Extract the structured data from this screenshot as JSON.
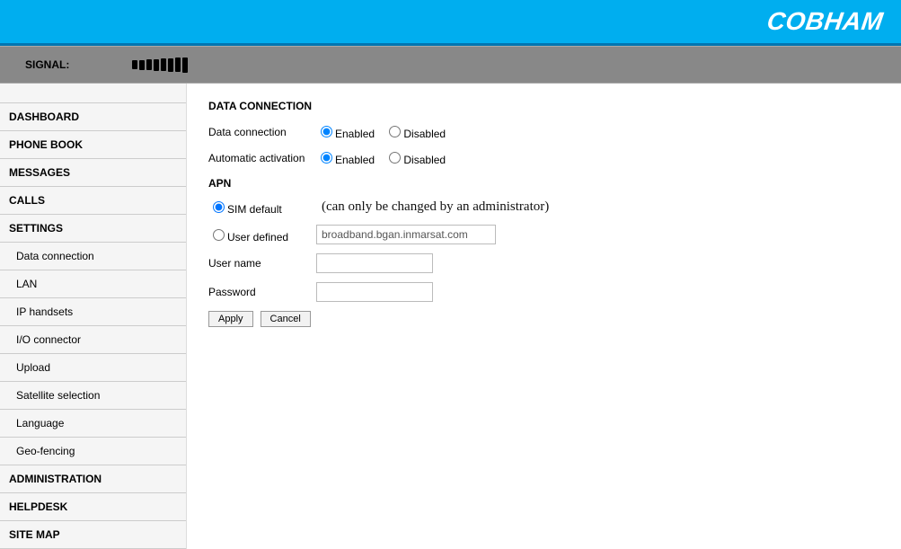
{
  "brand": "COBHAM",
  "signal": {
    "label": "SIGNAL:"
  },
  "sidebar": {
    "items": [
      {
        "label": "DASHBOARD"
      },
      {
        "label": "PHONE BOOK"
      },
      {
        "label": "MESSAGES"
      },
      {
        "label": "CALLS"
      },
      {
        "label": "SETTINGS"
      }
    ],
    "settings_sub": [
      {
        "label": "Data connection"
      },
      {
        "label": "LAN"
      },
      {
        "label": "IP handsets"
      },
      {
        "label": "I/O connector"
      },
      {
        "label": "Upload"
      },
      {
        "label": "Satellite selection"
      },
      {
        "label": "Language"
      },
      {
        "label": "Geo-fencing"
      }
    ],
    "bottom": [
      {
        "label": "ADMINISTRATION"
      },
      {
        "label": "HELPDESK"
      },
      {
        "label": "SITE MAP"
      }
    ]
  },
  "main": {
    "title": "DATA CONNECTION",
    "data_connection": {
      "label": "Data connection",
      "enabled": "Enabled",
      "disabled": "Disabled"
    },
    "auto_activation": {
      "label": "Automatic activation",
      "enabled": "Enabled",
      "disabled": "Disabled"
    },
    "apn": {
      "title": "APN",
      "sim_default": "SIM default",
      "hint": "(can only be changed by an administrator)",
      "user_defined": "User defined",
      "user_defined_value": "broadband.bgan.inmarsat.com",
      "username_label": "User name",
      "username_value": "",
      "password_label": "Password",
      "password_value": ""
    },
    "buttons": {
      "apply": "Apply",
      "cancel": "Cancel"
    }
  }
}
